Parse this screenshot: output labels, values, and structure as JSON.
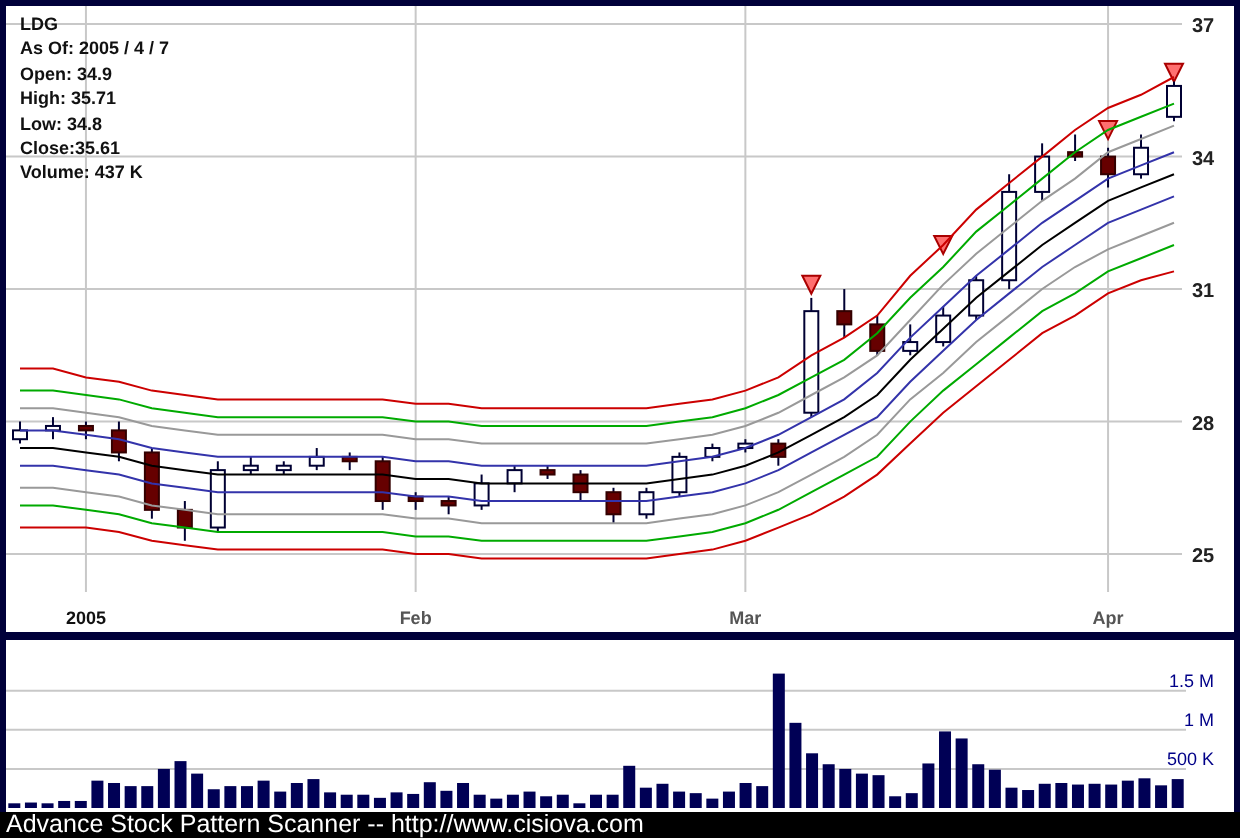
{
  "price_panel": {
    "info": [
      "LDG",
      "As Of: 2005 / 4 / 7",
      "Open: 34.9",
      "High: 35.71",
      "Low: 34.8",
      "Close:35.61",
      "Volume: 437 K"
    ],
    "chart_data": {
      "type": "candlestick",
      "grid": true,
      "categories": [
        null,
        null,
        "2005",
        null,
        null,
        null,
        null,
        null,
        null,
        null,
        null,
        null,
        "Feb",
        null,
        null,
        null,
        null,
        null,
        null,
        null,
        null,
        null,
        "Mar",
        null,
        null,
        null,
        null,
        null,
        null,
        null,
        null,
        null,
        null,
        "Apr",
        null,
        null
      ],
      "ylim": [
        24.14,
        37.41
      ],
      "yticks": [
        25,
        28,
        31,
        34,
        37
      ],
      "ohlc": [
        [
          27.6,
          28.0,
          27.5,
          27.8
        ],
        [
          27.8,
          28.1,
          27.6,
          27.9
        ],
        [
          27.9,
          28.0,
          27.6,
          27.8
        ],
        [
          27.8,
          28.0,
          27.1,
          27.3
        ],
        [
          27.3,
          27.4,
          25.8,
          26.0
        ],
        [
          26.0,
          26.2,
          25.3,
          25.6
        ],
        [
          25.6,
          27.1,
          25.5,
          26.9
        ],
        [
          26.9,
          27.2,
          26.8,
          27.0
        ],
        [
          26.9,
          27.1,
          26.8,
          27.0
        ],
        [
          27.0,
          27.4,
          26.9,
          27.2
        ],
        [
          27.2,
          27.3,
          26.9,
          27.1
        ],
        [
          27.1,
          27.2,
          26.0,
          26.2
        ],
        [
          26.3,
          26.4,
          26.0,
          26.2
        ],
        [
          26.2,
          26.3,
          25.9,
          26.1
        ],
        [
          26.1,
          26.8,
          26.0,
          26.6
        ],
        [
          26.6,
          27.0,
          26.4,
          26.9
        ],
        [
          26.9,
          27.0,
          26.7,
          26.8
        ],
        [
          26.8,
          26.9,
          26.2,
          26.4
        ],
        [
          26.4,
          26.5,
          25.7,
          25.9
        ],
        [
          25.9,
          26.5,
          25.8,
          26.4
        ],
        [
          26.4,
          27.3,
          26.3,
          27.2
        ],
        [
          27.2,
          27.5,
          27.1,
          27.4
        ],
        [
          27.4,
          27.6,
          27.3,
          27.5
        ],
        [
          27.5,
          27.6,
          27.0,
          27.2
        ],
        [
          28.2,
          30.8,
          28.1,
          30.5
        ],
        [
          30.5,
          31.0,
          29.9,
          30.2
        ],
        [
          30.2,
          30.4,
          29.5,
          29.6
        ],
        [
          29.6,
          30.2,
          29.5,
          29.8
        ],
        [
          29.8,
          30.6,
          29.7,
          30.4
        ],
        [
          30.4,
          31.3,
          30.3,
          31.2
        ],
        [
          31.2,
          33.6,
          31.0,
          33.2
        ],
        [
          33.2,
          34.3,
          33.0,
          34.0
        ],
        [
          34.1,
          34.5,
          33.9,
          34.0
        ],
        [
          34.0,
          34.2,
          33.3,
          33.6
        ],
        [
          33.6,
          34.5,
          33.5,
          34.2
        ],
        [
          34.9,
          35.7,
          34.8,
          35.6
        ]
      ],
      "series": [
        {
          "type": "line",
          "color": "#cc0000",
          "values": [
            29.2,
            29.2,
            29.0,
            28.9,
            28.7,
            28.6,
            28.5,
            28.5,
            28.5,
            28.5,
            28.5,
            28.5,
            28.4,
            28.4,
            28.3,
            28.3,
            28.3,
            28.3,
            28.3,
            28.3,
            28.4,
            28.5,
            28.7,
            29.0,
            29.5,
            29.9,
            30.4,
            31.3,
            32.0,
            32.8,
            33.4,
            34.0,
            34.6,
            35.1,
            35.4,
            35.8
          ]
        },
        {
          "type": "line",
          "color": "#00aa00",
          "values": [
            28.7,
            28.7,
            28.6,
            28.5,
            28.3,
            28.2,
            28.1,
            28.1,
            28.1,
            28.1,
            28.1,
            28.1,
            28.0,
            28.0,
            27.9,
            27.9,
            27.9,
            27.9,
            27.9,
            27.9,
            28.0,
            28.1,
            28.3,
            28.6,
            29.0,
            29.4,
            30.0,
            30.8,
            31.5,
            32.3,
            32.9,
            33.5,
            34.1,
            34.6,
            34.9,
            35.2
          ]
        },
        {
          "type": "line",
          "color": "#999999",
          "values": [
            28.3,
            28.3,
            28.2,
            28.1,
            27.9,
            27.8,
            27.7,
            27.7,
            27.7,
            27.7,
            27.7,
            27.7,
            27.6,
            27.6,
            27.5,
            27.5,
            27.5,
            27.5,
            27.5,
            27.5,
            27.6,
            27.7,
            27.9,
            28.2,
            28.6,
            29.0,
            29.5,
            30.3,
            31.1,
            31.8,
            32.4,
            33.0,
            33.5,
            34.1,
            34.4,
            34.7
          ]
        },
        {
          "type": "line",
          "color": "#3333aa",
          "values": [
            27.8,
            27.8,
            27.7,
            27.6,
            27.4,
            27.3,
            27.2,
            27.2,
            27.2,
            27.2,
            27.2,
            27.2,
            27.1,
            27.1,
            27.0,
            27.0,
            27.0,
            27.0,
            27.0,
            27.0,
            27.1,
            27.2,
            27.4,
            27.7,
            28.1,
            28.5,
            29.1,
            29.9,
            30.6,
            31.3,
            31.9,
            32.5,
            33.0,
            33.5,
            33.8,
            34.1
          ]
        },
        {
          "type": "line",
          "color": "#000000",
          "values": [
            27.4,
            27.4,
            27.3,
            27.2,
            27.0,
            26.9,
            26.8,
            26.8,
            26.8,
            26.8,
            26.8,
            26.8,
            26.7,
            26.7,
            26.6,
            26.6,
            26.6,
            26.6,
            26.6,
            26.6,
            26.7,
            26.8,
            27.0,
            27.3,
            27.7,
            28.1,
            28.6,
            29.4,
            30.1,
            30.8,
            31.4,
            32.0,
            32.5,
            33.0,
            33.3,
            33.6
          ]
        },
        {
          "type": "line",
          "color": "#3333aa",
          "values": [
            27.0,
            27.0,
            26.9,
            26.8,
            26.6,
            26.5,
            26.4,
            26.4,
            26.4,
            26.4,
            26.4,
            26.4,
            26.3,
            26.3,
            26.2,
            26.2,
            26.2,
            26.2,
            26.2,
            26.2,
            26.3,
            26.4,
            26.6,
            26.9,
            27.3,
            27.7,
            28.1,
            28.9,
            29.6,
            30.3,
            30.9,
            31.5,
            32.0,
            32.5,
            32.8,
            33.1
          ]
        },
        {
          "type": "line",
          "color": "#999999",
          "values": [
            26.5,
            26.5,
            26.4,
            26.3,
            26.1,
            26.0,
            25.9,
            25.9,
            25.9,
            25.9,
            25.9,
            25.9,
            25.8,
            25.8,
            25.7,
            25.7,
            25.7,
            25.7,
            25.7,
            25.7,
            25.8,
            25.9,
            26.1,
            26.4,
            26.8,
            27.2,
            27.7,
            28.5,
            29.1,
            29.8,
            30.4,
            31.0,
            31.5,
            31.9,
            32.2,
            32.5
          ]
        },
        {
          "type": "line",
          "color": "#00aa00",
          "values": [
            26.1,
            26.1,
            26.0,
            25.9,
            25.7,
            25.6,
            25.5,
            25.5,
            25.5,
            25.5,
            25.5,
            25.5,
            25.4,
            25.4,
            25.3,
            25.3,
            25.3,
            25.3,
            25.3,
            25.3,
            25.4,
            25.5,
            25.7,
            26.0,
            26.4,
            26.8,
            27.2,
            28.0,
            28.7,
            29.3,
            29.9,
            30.5,
            30.9,
            31.4,
            31.7,
            32.0
          ]
        },
        {
          "type": "line",
          "color": "#cc0000",
          "values": [
            25.6,
            25.6,
            25.6,
            25.5,
            25.3,
            25.2,
            25.1,
            25.1,
            25.1,
            25.1,
            25.1,
            25.1,
            25.0,
            25.0,
            24.9,
            24.9,
            24.9,
            24.9,
            24.9,
            24.9,
            25.0,
            25.1,
            25.3,
            25.6,
            25.9,
            26.3,
            26.8,
            27.5,
            28.2,
            28.8,
            29.4,
            30.0,
            30.4,
            30.9,
            31.2,
            31.4
          ]
        },
        {
          "type": "scatter",
          "color": "#ff6f6f",
          "values": [
            null,
            null,
            null,
            null,
            null,
            null,
            null,
            null,
            null,
            null,
            null,
            null,
            null,
            null,
            null,
            null,
            null,
            null,
            null,
            null,
            null,
            null,
            null,
            null,
            31.1,
            null,
            null,
            null,
            32.0,
            null,
            null,
            null,
            null,
            34.6,
            null,
            35.9
          ]
        }
      ]
    }
  },
  "volume_panel": {
    "chart_data": {
      "type": "bar",
      "grid": true,
      "ylim": [
        0,
        2.15
      ],
      "yticks": [
        {
          "value": 0.5,
          "label": "500 K"
        },
        {
          "value": 1,
          "label": "1 M"
        },
        {
          "value": 1.5,
          "label": "1.5 M"
        }
      ],
      "series": [
        {
          "color": "#000055",
          "values": [
            0.06,
            0.07,
            0.06,
            0.09,
            0.09,
            0.35,
            0.32,
            0.28,
            0.28,
            0.5,
            0.6,
            0.44,
            0.24,
            0.28,
            0.28,
            0.35,
            0.21,
            0.32,
            0.37,
            0.2,
            0.17,
            0.17,
            0.13,
            0.2,
            0.18,
            0.33,
            0.22,
            0.32,
            0.17,
            0.12,
            0.17,
            0.21,
            0.15,
            0.17,
            0.06,
            0.17,
            0.17,
            0.54,
            0.26,
            0.31,
            0.21,
            0.19,
            0.12,
            0.21,
            0.32,
            0.28,
            1.72,
            1.09,
            0.7,
            0.56,
            0.5,
            0.44,
            0.42,
            0.15,
            0.19,
            0.57,
            0.98,
            0.89,
            0.56,
            0.49,
            0.26,
            0.23,
            0.31,
            0.32,
            0.3,
            0.31,
            0.3,
            0.35,
            0.38,
            0.29,
            0.37
          ]
        }
      ]
    }
  },
  "footer": "Advance Stock Pattern Scanner -- http://www.cisiova.com"
}
